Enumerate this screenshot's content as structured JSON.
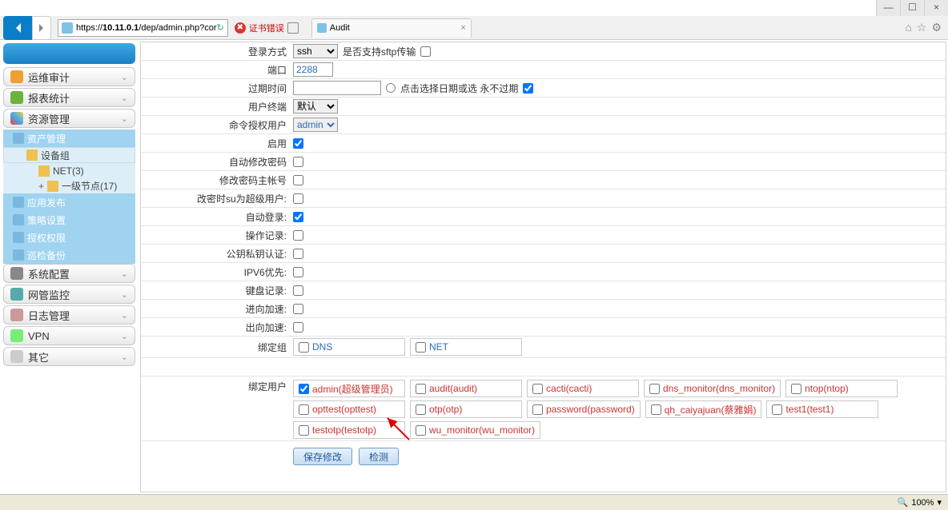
{
  "window": {
    "min": "—",
    "max": "☐",
    "close": "×"
  },
  "toolbar": {
    "url_prefix": "https://",
    "url_host": "10.11.0.1",
    "url_path": "/dep/admin.php?cor",
    "refresh_glyph": "↻",
    "cert_err": "证书错误",
    "tab_title": "Audit",
    "tab_close": "×",
    "home": "⌂",
    "star": "☆",
    "gear": "⚙"
  },
  "sidebar": {
    "sections": {
      "audit": "运维审计",
      "report": "报表统计",
      "resource": "资源管理",
      "sysconf": "系统配置",
      "netmon": "网管监控",
      "logmgmt": "日志管理",
      "vpn": "VPN",
      "other": "其它"
    },
    "chev": "⌄",
    "resource_items": {
      "asset": "资产管理",
      "devgrp": "设备组",
      "net3": "NET(3)",
      "tree_plus": "+",
      "lvl1node": "一级节点(17)",
      "publish": "应用发布",
      "policy": "策略设置",
      "auth": "授权权限",
      "backup": "巡检备份"
    }
  },
  "form": {
    "rows": {
      "login_method": "登录方式",
      "login_method_val": "ssh",
      "sftp_label": "是否支持sftp传输",
      "port": "端口",
      "port_val": "2288",
      "expire": "过期时间",
      "expire_hint": "点击选择日期或选 永不过期",
      "terminal": "用户终端",
      "terminal_val": "默认",
      "cmduser": "命令授权用户",
      "cmduser_val": "admin",
      "enable": "启用",
      "autopwd": "自动修改密码",
      "pwdmaster": "修改密码主帐号",
      "su_super": "改密时su为超级用户:",
      "autologin": "自动登录:",
      "oprecord": "操作记录:",
      "pubkey": "公钥私钥认证:",
      "ipv6": "IPV6优先:",
      "keyboard": "键盘记录:",
      "accel_in": "进向加速:",
      "accel_out": "出向加速:",
      "bindgrp": "绑定组",
      "binduser": "绑定用户"
    },
    "groups": {
      "dns": "DNS",
      "net": "NET"
    },
    "users": [
      "admin(超级管理员)",
      "audit(audit)",
      "cacti(cacti)",
      "dns_monitor(dns_monitor)",
      "ntop(ntop)",
      "opttest(opttest)",
      "otp(otp)",
      "password(password)",
      "qh_caiyajuan(蔡雅娟)",
      "test1(test1)",
      "testotp(testotp)",
      "wu_monitor(wu_monitor)"
    ],
    "save_btn": "保存修改",
    "detect_btn": "检测"
  },
  "statusbar": {
    "zoom": "100%",
    "zoom_caret": "▾"
  }
}
